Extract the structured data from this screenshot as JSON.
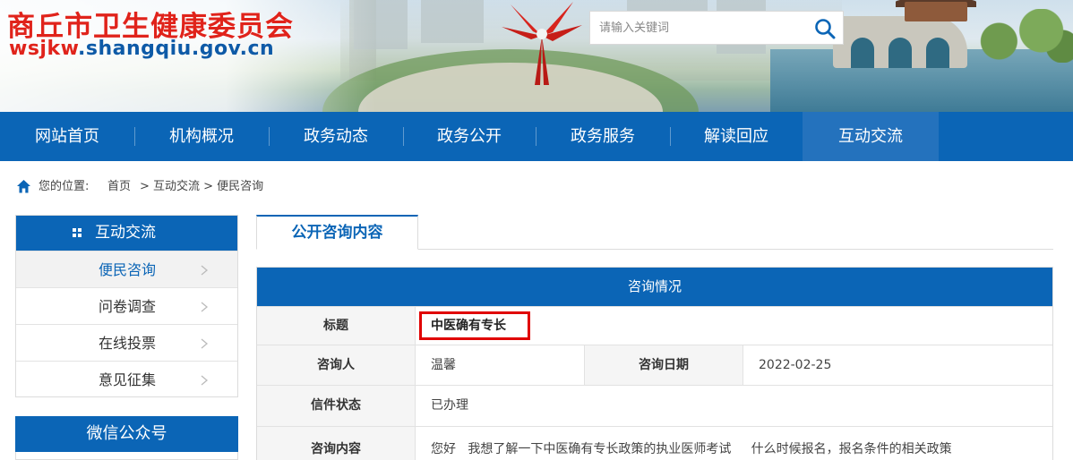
{
  "site": {
    "title": "商丘市卫生健康委员会",
    "url_prefix": "wsjkw",
    "url_rest": ".shangqiu.gov.cn"
  },
  "search": {
    "placeholder": "请输入关键词",
    "icon": "search-icon"
  },
  "nav": {
    "items": [
      "网站首页",
      "机构概况",
      "政务动态",
      "政务公开",
      "政务服务",
      "解读回应",
      "互动交流"
    ],
    "active_index": 6
  },
  "breadcrumb": {
    "prefix": "您的位置:",
    "home": "首页",
    "path": "> 互动交流 > 便民咨询"
  },
  "sidebar": {
    "title": "互动交流",
    "items": [
      {
        "label": "便民咨询",
        "active": true
      },
      {
        "label": "问卷调查",
        "active": false
      },
      {
        "label": "在线投票",
        "active": false
      },
      {
        "label": "意见征集",
        "active": false
      }
    ],
    "wechat_title": "微信公众号"
  },
  "main": {
    "tab_label": "公开咨询内容",
    "table_title": "咨询情况",
    "rows": {
      "title_label": "标题",
      "title_value": "中医确有专长",
      "asker_label": "咨询人",
      "asker_value": "温馨",
      "date_label": "咨询日期",
      "date_value": "2022-02-25",
      "status_label": "信件状态",
      "status_value": "已办理",
      "content_label": "咨询内容",
      "content_value": "您好   我想了解一下中医确有专长政策的执业医师考试     什么时候报名，报名条件的相关政策"
    }
  },
  "colors": {
    "brand_blue": "#0b65b6",
    "title_red": "#e0231b",
    "highlight_red": "#e00000"
  }
}
